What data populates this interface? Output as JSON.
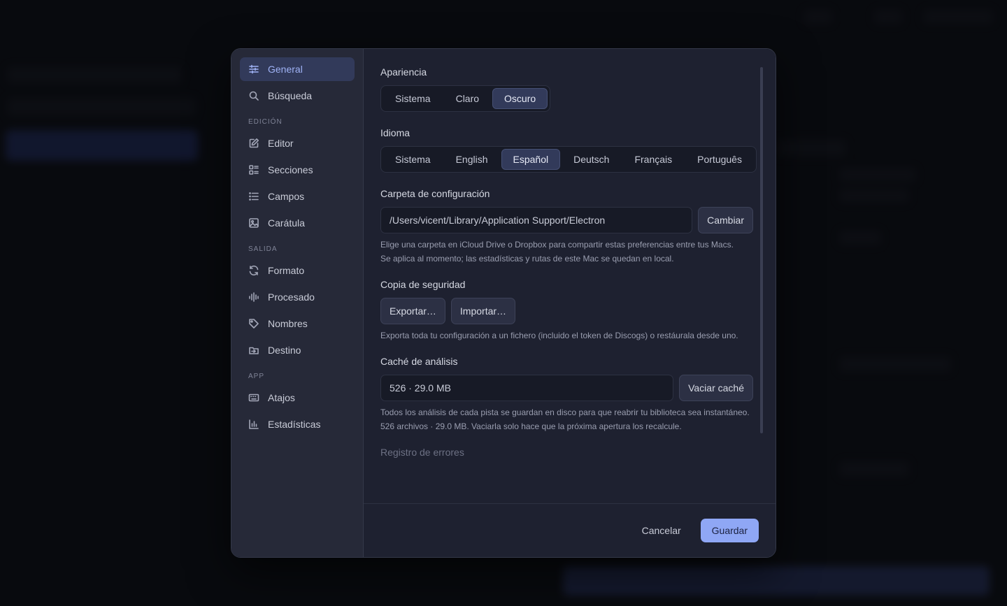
{
  "sidebar": {
    "items_top": [
      {
        "label": "General",
        "icon": "sliders-icon",
        "active": true
      },
      {
        "label": "Búsqueda",
        "icon": "search-icon"
      }
    ],
    "sections": [
      {
        "label": "EDICIÓN",
        "items": [
          {
            "label": "Editor",
            "icon": "edit-icon"
          },
          {
            "label": "Secciones",
            "icon": "sections-icon"
          },
          {
            "label": "Campos",
            "icon": "list-icon"
          },
          {
            "label": "Carátula",
            "icon": "image-icon"
          }
        ]
      },
      {
        "label": "SALIDA",
        "items": [
          {
            "label": "Formato",
            "icon": "refresh-icon"
          },
          {
            "label": "Procesado",
            "icon": "waveform-icon"
          },
          {
            "label": "Nombres",
            "icon": "tag-icon"
          },
          {
            "label": "Destino",
            "icon": "folder-icon"
          }
        ]
      },
      {
        "label": "APP",
        "items": [
          {
            "label": "Atajos",
            "icon": "keyboard-icon"
          },
          {
            "label": "Estadísticas",
            "icon": "chart-icon"
          }
        ]
      }
    ]
  },
  "appearance": {
    "title": "Apariencia",
    "options": [
      "Sistema",
      "Claro",
      "Oscuro"
    ],
    "selected": "Oscuro"
  },
  "language": {
    "title": "Idioma",
    "options": [
      "Sistema",
      "English",
      "Español",
      "Deutsch",
      "Français",
      "Português"
    ],
    "selected": "Español"
  },
  "config_folder": {
    "title": "Carpeta de configuración",
    "path": "/Users/vicent/Library/Application Support/Electron",
    "button": "Cambiar",
    "help": "Elige una carpeta en iCloud Drive o Dropbox para compartir estas preferencias entre tus Macs. Se aplica al momento; las estadísticas y rutas de este Mac se quedan en local."
  },
  "backup": {
    "title": "Copia de seguridad",
    "export": "Exportar…",
    "import": "Importar…",
    "help": "Exporta toda tu configuración a un fichero (incluido el token de Discogs) o restáurala desde uno."
  },
  "cache": {
    "title": "Caché de análisis",
    "value": "526 · 29.0 MB",
    "button": "Vaciar caché",
    "help": "Todos los análisis de cada pista se guardan en disco para que reabrir tu biblioteca sea instantáneo. 526 archivos · 29.0 MB. Vaciarla solo hace que la próxima apertura los recalcule."
  },
  "error_log": {
    "title": "Registro de errores"
  },
  "footer": {
    "cancel": "Cancelar",
    "save": "Guardar"
  },
  "colors": {
    "accent": "#8fa7f5",
    "active_bg": "#323a5a",
    "panel": "#1e2130",
    "sidebar": "#262938"
  }
}
